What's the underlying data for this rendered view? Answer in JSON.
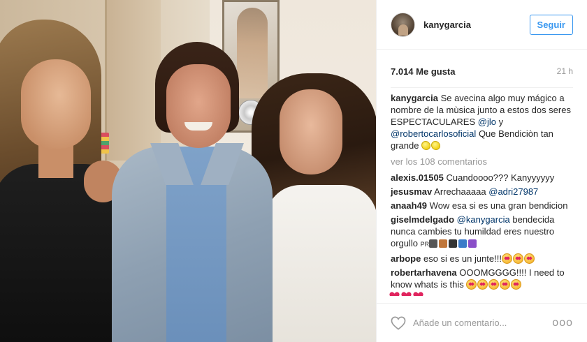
{
  "post": {
    "photo_alt": "Three people posing together backstage"
  },
  "header": {
    "username": "kanygarcia",
    "follow_label": "Seguir"
  },
  "meta": {
    "likes": "7.014 Me gusta",
    "time": "21 h"
  },
  "caption": {
    "user": "kanygarcia",
    "text_1": "Se avecina algo muy mágico a nombre de la mùsica junto a estos dos seres ESPECTACULARES",
    "mention_1": "@jlo",
    "text_2": "y",
    "mention_2": "@robertocarlosoficial",
    "text_3": "Que Bendiciòn tan grande"
  },
  "view_more": "ver los 108 comentarios",
  "comments": [
    {
      "user": "alexis.01505",
      "text": "Cuandoooo??? Kanyyyyyy"
    },
    {
      "user": "jesusmav",
      "text": "Arrechaaaaa",
      "mention": "@adri27987"
    },
    {
      "user": "anaah49",
      "text": "Wow esa si es una gran bendicion"
    },
    {
      "user": "giselmdelgado",
      "mention": "@kanygarcia",
      "text": "bendecida nunca cambies tu humildad eres nuestro orgullo",
      "tail": "PR"
    },
    {
      "user": "arbope",
      "text": "eso si es un junte!!!"
    },
    {
      "user": "robertarhavena",
      "text": "OOOMGGGG!!!! I need to know whats is this"
    }
  ],
  "footer": {
    "placeholder": "Añade un comentario...",
    "options": "ooo"
  },
  "colors": {
    "accent": "#3897f0",
    "mention": "#003569",
    "muted": "#999999"
  },
  "icons": [
    "heart-icon",
    "options-icon",
    "lemon-emoji",
    "heart-eyes-emoji",
    "red-heart-emoji"
  ]
}
